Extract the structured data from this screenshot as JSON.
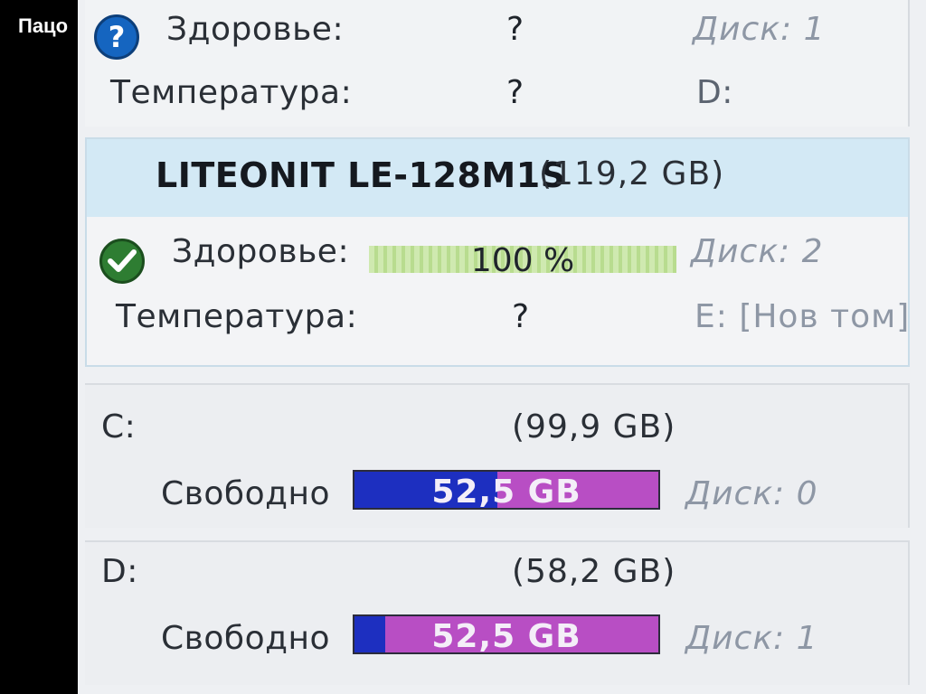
{
  "watermark": "Пацо",
  "disk1": {
    "icon": "question-icon",
    "health_label": "Здоровье:",
    "health_value": "?",
    "disk_label": "Диск: 1",
    "temp_label": "Температура:",
    "temp_value": "?",
    "drive_letter": "D:"
  },
  "disk2": {
    "model": "LITEONIT LE-128M1S",
    "capacity": "(119,2 GB)",
    "icon": "checkmark-icon",
    "health_label": "Здоровье:",
    "health_value": "100 %",
    "health_percent": 100,
    "disk_label": "Диск: 2",
    "temp_label": "Температура:",
    "temp_value": "?",
    "volume": "E: [Нов том]"
  },
  "volumes": [
    {
      "letter": "C:",
      "size": "(99,9 GB)",
      "free_label": "Свободно",
      "free_value": "52,5 GB",
      "used_fraction": 0.47,
      "disk_label": "Диск: 0"
    },
    {
      "letter": "D:",
      "size": "(58,2 GB)",
      "free_label": "Свободно",
      "free_value": "52,5 GB",
      "used_fraction": 0.1,
      "disk_label": "Диск: 1"
    }
  ],
  "colors": {
    "used": "#1d2fc0",
    "free": "#b84ec4",
    "health_good": "#b8dc8f"
  }
}
